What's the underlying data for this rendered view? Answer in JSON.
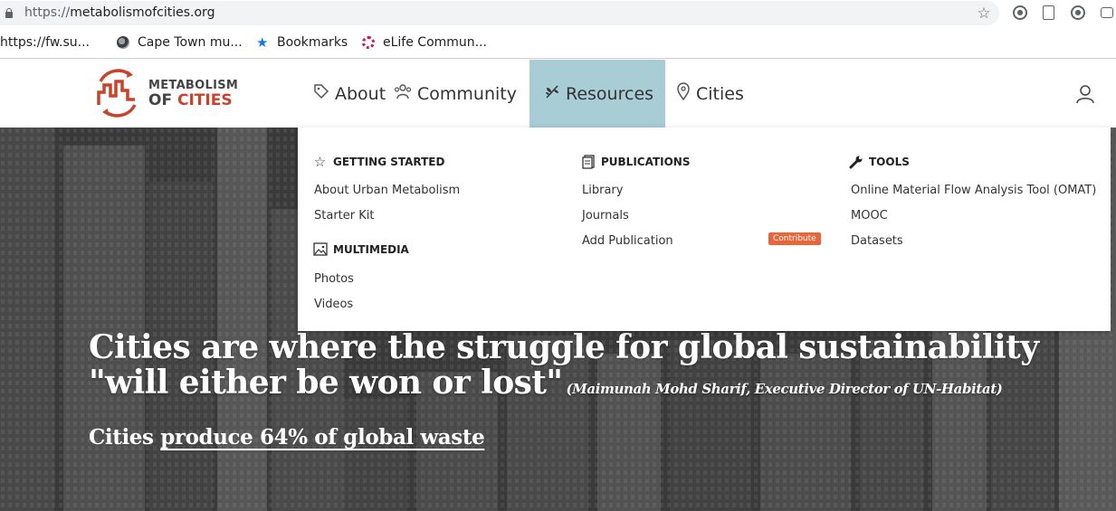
{
  "browser": {
    "url_scheme": "https://",
    "url_host": "metabolismofcities.org",
    "bookmarks": [
      {
        "label": "https://fw.su..."
      },
      {
        "label": "Cape Town mu..."
      },
      {
        "label": "Bookmarks"
      },
      {
        "label": "eLife Commun..."
      }
    ]
  },
  "header": {
    "logo_line1": "METABOLISM",
    "logo_line2_of": "OF",
    "logo_line2_cities": "CITIES",
    "brand_color": "#c8422c",
    "nav": [
      {
        "label": "About",
        "icon": "tag-icon"
      },
      {
        "label": "Community",
        "icon": "people-icon"
      },
      {
        "label": "Resources",
        "icon": "leaf-icon",
        "active": true
      },
      {
        "label": "Cities",
        "icon": "map-pin-icon"
      }
    ],
    "active_color": "#a8cdd5"
  },
  "dropdown": {
    "getting_started": {
      "title": "GETTING STARTED",
      "links": [
        "About Urban Metabolism",
        "Starter Kit"
      ]
    },
    "multimedia": {
      "title": "MULTIMEDIA",
      "links": [
        "Photos",
        "Videos"
      ]
    },
    "publications": {
      "title": "PUBLICATIONS",
      "links": [
        "Library",
        "Journals",
        "Add Publication"
      ],
      "badge": "Contribute"
    },
    "tools": {
      "title": "TOOLS",
      "links": [
        "Online Material Flow Analysis Tool (OMAT)",
        "MOOC",
        "Datasets"
      ]
    }
  },
  "hero": {
    "quote_line1": "Cities are where the struggle for global sustainability",
    "quote_line2": "\"will either be won or lost\"",
    "attribution": "(Maimunah Mohd Sharif, Executive Director of UN-Habitat)",
    "stat_prefix": "Cities",
    "stat_link": "produce 64% of global waste"
  }
}
